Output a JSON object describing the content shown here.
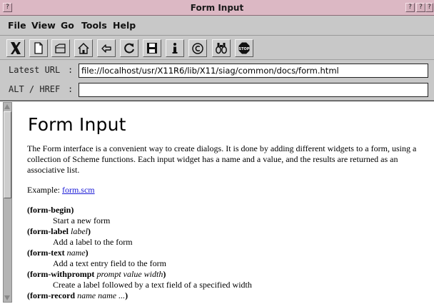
{
  "window": {
    "title": "Form Input",
    "left_button_glyph": "?",
    "right_button_glyphs": [
      "?",
      "?",
      "?"
    ]
  },
  "menu": [
    "File",
    "View",
    "Go",
    "Tools",
    "Help"
  ],
  "toolbar": {
    "icons": [
      "x-logo-icon",
      "new-document-icon",
      "open-folder-icon",
      "home-icon",
      "back-arrow-icon",
      "reload-icon",
      "save-disk-icon",
      "info-icon",
      "copyright-icon",
      "binoculars-icon",
      "stop-icon"
    ],
    "stop_label": "STOP"
  },
  "url_row": {
    "label": "Latest URL",
    "colon": ":",
    "value": "file://localhost/usr/X11R6/lib/X11/siag/common/docs/form.html"
  },
  "alt_row": {
    "label": "ALT / HREF",
    "colon": ":",
    "value": ""
  },
  "document": {
    "heading": "Form Input",
    "intro": "The Form interface is a convenient way to create dialogs. It is done by adding different widgets to a form, using a collection of Scheme functions. Each input widget has a name and a value, and the results are returned as an associative list.",
    "example_label": "Example:",
    "example_link": "form.scm",
    "functions": [
      {
        "name": "(form-begin",
        "args": "",
        "close": ")",
        "description": "Start a new form"
      },
      {
        "name": "(form-label",
        "args": "label",
        "close": ")",
        "description": "Add a label to the form"
      },
      {
        "name": "(form-text",
        "args": "name",
        "close": ")",
        "description": "Add a text entry field to the form"
      },
      {
        "name": "(form-withprompt",
        "args": "prompt value width",
        "close": ")",
        "description": "Create a label followed by a text field of a specified width"
      },
      {
        "name": "(form-record",
        "args": "name name ...",
        "close": ")",
        "description": ""
      }
    ]
  }
}
